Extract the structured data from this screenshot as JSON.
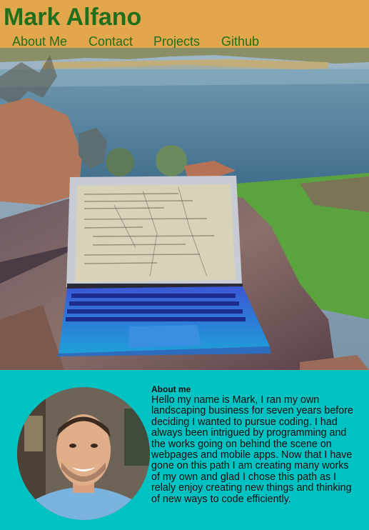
{
  "header": {
    "title": "Mark Alfano"
  },
  "nav": {
    "items": [
      "About Me",
      "Contact",
      "Projects",
      "Github"
    ]
  },
  "hero": {
    "description_icon": "laptop-on-table-photo"
  },
  "about": {
    "heading": "About me",
    "body": "Hello my name is Mark, I ran my own landscaping business for seven years before deciding I wanted to pursue coding. I had always been intrigued by programming and the works going on behind the scene on webpages and mobile apps. Now that I have gone on this path I am creating many works of my own and glad I chose this path as I relaly enjoy creating new things and thinking of new ways to code efficiently."
  },
  "colors": {
    "header_bg": "#e2a64c",
    "title": "#1f6f1d",
    "about_bg": "#00c2c2"
  }
}
